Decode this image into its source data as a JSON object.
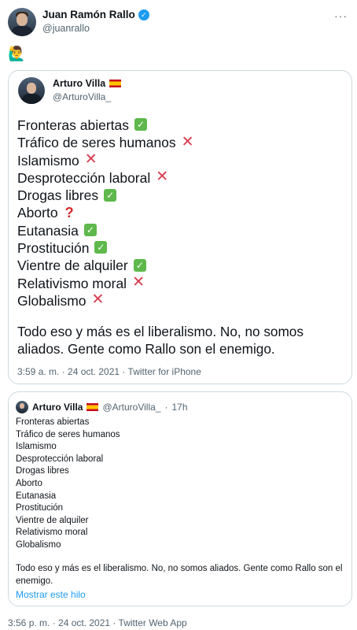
{
  "tweet": {
    "author_name": "Juan Ramón Rallo",
    "author_handle": "@juanrallo",
    "emoji": "🙋‍♂️",
    "footer": "3:56 p. m. · 24 oct. 2021 · Twitter Web App"
  },
  "quoted": {
    "author_name": "Arturo Villa",
    "author_handle": "@ArturoVilla_",
    "items": [
      {
        "text": "Fronteras abiertas",
        "mark": "check"
      },
      {
        "text": "Tráfico de seres humanos",
        "mark": "cross"
      },
      {
        "text": "Islamismo",
        "mark": "cross"
      },
      {
        "text": "Desprotección laboral",
        "mark": "cross"
      },
      {
        "text": "Drogas libres",
        "mark": "check"
      },
      {
        "text": "Aborto",
        "mark": "question"
      },
      {
        "text": "Eutanasia",
        "mark": "check"
      },
      {
        "text": "Prostitución",
        "mark": "check"
      },
      {
        "text": "Vientre de alquiler",
        "mark": "check"
      },
      {
        "text": "Relativismo moral",
        "mark": "cross"
      },
      {
        "text": "Globalismo",
        "mark": "cross"
      }
    ],
    "body": "Todo eso y más es el liberalismo. No, no somos aliados. Gente como Rallo son el enemigo.",
    "meta": "3:59 a. m. · 24 oct. 2021 · Twitter for iPhone"
  },
  "nested_quote": {
    "author_name": "Arturo Villa",
    "author_handle": "@ArturoVilla_",
    "separator": "·",
    "time": "17h",
    "lines": [
      "Fronteras abiertas",
      "Tráfico de seres humanos",
      "Islamismo",
      "Desprotección laboral",
      "Drogas libres",
      "Aborto",
      "Eutanasia",
      "Prostitución",
      "Vientre de alquiler",
      "Relativismo moral",
      "Globalismo"
    ],
    "body": "Todo eso y más es el liberalismo. No, no somos aliados. Gente como Rallo son el enemigo.",
    "show_thread": "Mostrar este hilo"
  },
  "colors": {
    "accent": "#1d9bf0",
    "check": "#5eb84b",
    "cross": "#d93a4e",
    "muted": "#536471",
    "border": "#cfd9de"
  },
  "icons": {
    "verified": "verified-badge-icon",
    "more": "more-options-icon",
    "flag": "spain-flag-icon"
  }
}
